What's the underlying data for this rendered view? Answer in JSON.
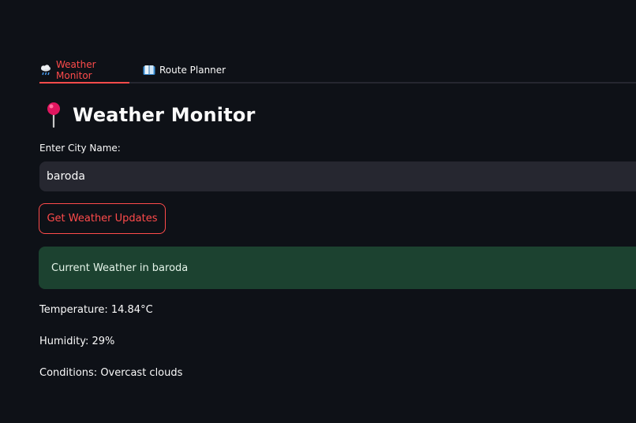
{
  "tabs": [
    {
      "label": "Weather Monitor",
      "icon": "rain-cloud-icon",
      "active": true
    },
    {
      "label": "Route Planner",
      "icon": "map-icon",
      "active": false
    }
  ],
  "header": {
    "icon": "round-pushpin-icon",
    "title": "Weather Monitor"
  },
  "form": {
    "city_label": "Enter City Name:",
    "city_value": "baroda",
    "submit_label": "Get Weather Updates"
  },
  "result": {
    "success_message": "Current Weather in baroda",
    "temperature": "Temperature: 14.84°C",
    "humidity": "Humidity: 29%",
    "conditions": "Conditions: Overcast clouds"
  },
  "colors": {
    "background": "#0e1117",
    "accent": "#ff4b4b",
    "input_bg": "#262730",
    "success_bg": "#1c4230"
  }
}
